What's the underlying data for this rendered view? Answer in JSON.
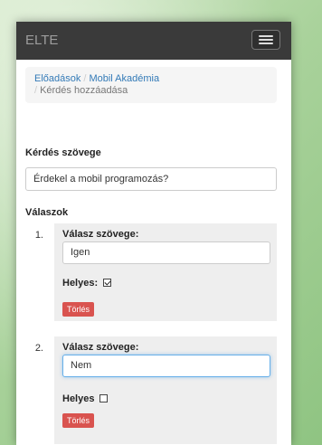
{
  "navbar": {
    "brand": "ELTE",
    "menu_icon": "hamburger-menu-icon"
  },
  "breadcrumb": {
    "items": [
      "Előadások",
      "Mobil Akadémia",
      "Kérdés hozzáadása"
    ],
    "separator": "/"
  },
  "question": {
    "label": "Kérdés szövege",
    "value": "Érdekel a mobil programozás?"
  },
  "answers": {
    "label": "Válaszok",
    "items": [
      {
        "number": "1.",
        "label": "Válasz szövege:",
        "value": "Igen",
        "correct_label": "Helyes:",
        "correct": true,
        "delete_label": "Törlés"
      },
      {
        "number": "2.",
        "label": "Válasz szövege:",
        "value": "Nem",
        "correct_label": "Helyes",
        "correct": false,
        "delete_label": "Törlés"
      }
    ]
  },
  "colors": {
    "navbar": "#3a3a3a",
    "link": "#337ab7",
    "danger": "#d9534f",
    "focus": "#66afe9"
  }
}
